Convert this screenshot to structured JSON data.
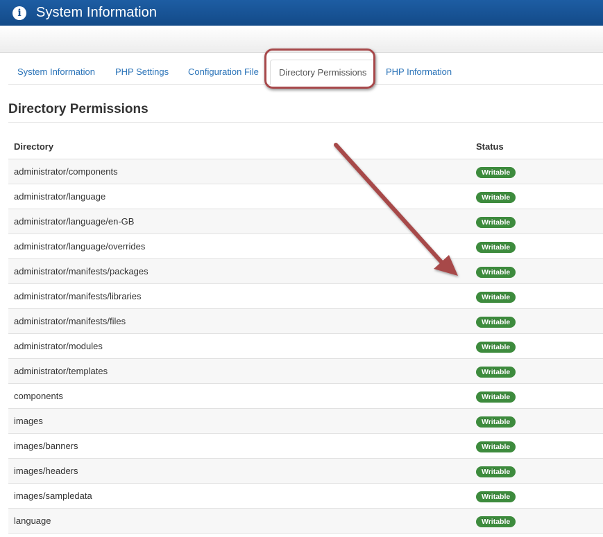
{
  "header": {
    "title": "System Information",
    "icon": "info-icon"
  },
  "tabs": [
    {
      "label": "System Information"
    },
    {
      "label": "PHP Settings"
    },
    {
      "label": "Configuration File"
    },
    {
      "label": "Directory Permissions",
      "active": true
    },
    {
      "label": "PHP Information"
    }
  ],
  "section": {
    "title": "Directory Permissions"
  },
  "table": {
    "columns": [
      "Directory",
      "Status"
    ],
    "rows": [
      {
        "directory": "administrator/components",
        "status": "Writable"
      },
      {
        "directory": "administrator/language",
        "status": "Writable"
      },
      {
        "directory": "administrator/language/en-GB",
        "status": "Writable"
      },
      {
        "directory": "administrator/language/overrides",
        "status": "Writable"
      },
      {
        "directory": "administrator/manifests/packages",
        "status": "Writable"
      },
      {
        "directory": "administrator/manifests/libraries",
        "status": "Writable"
      },
      {
        "directory": "administrator/manifests/files",
        "status": "Writable"
      },
      {
        "directory": "administrator/modules",
        "status": "Writable"
      },
      {
        "directory": "administrator/templates",
        "status": "Writable"
      },
      {
        "directory": "components",
        "status": "Writable"
      },
      {
        "directory": "images",
        "status": "Writable"
      },
      {
        "directory": "images/banners",
        "status": "Writable"
      },
      {
        "directory": "images/headers",
        "status": "Writable"
      },
      {
        "directory": "images/sampledata",
        "status": "Writable"
      },
      {
        "directory": "language",
        "status": "Writable"
      }
    ]
  },
  "colors": {
    "header": "#1a5598",
    "link": "#2a73b8",
    "badge": "#3d8b3d",
    "annotation": "#a7484a"
  }
}
